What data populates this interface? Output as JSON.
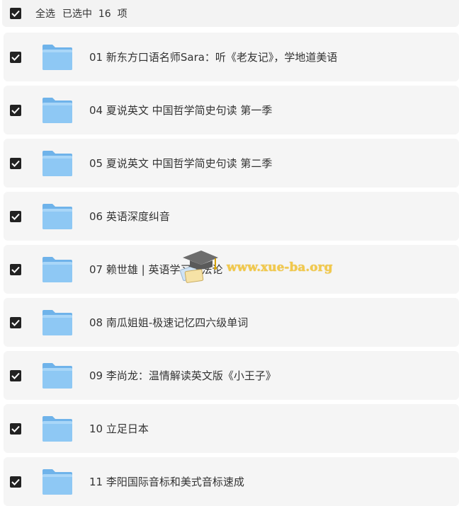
{
  "header": {
    "select_all_label": "全选",
    "selected_count_label": "已选中  16  项"
  },
  "items": [
    {
      "name": "01 新东方口语名师Sara：听《老友记》，学地道美语",
      "checked": true,
      "icon": "folder-icon"
    },
    {
      "name": "04 夏说英文 中国哲学简史句读 第一季",
      "checked": true,
      "icon": "folder-icon"
    },
    {
      "name": "05 夏说英文 中国哲学简史句读 第二季",
      "checked": true,
      "icon": "folder-icon"
    },
    {
      "name": "06 英语深度纠音",
      "checked": true,
      "icon": "folder-icon"
    },
    {
      "name": "07 赖世雄 | 英语学习方法论",
      "checked": true,
      "icon": "folder-icon"
    },
    {
      "name": "08 南瓜姐姐-极速记忆四六级单词",
      "checked": true,
      "icon": "folder-icon"
    },
    {
      "name": "09 李尚龙：温情解读英文版《小王子》",
      "checked": true,
      "icon": "folder-icon"
    },
    {
      "name": "10 立足日本",
      "checked": true,
      "icon": "folder-icon"
    },
    {
      "name": "11 李阳国际音标和美式音标速成",
      "checked": true,
      "icon": "folder-icon"
    }
  ],
  "watermark": {
    "text": "www.xue-ba.org",
    "icon": "graduation-cap-icon"
  },
  "colors": {
    "checkbox": "#222222",
    "folder_front": "#8ec8f4",
    "folder_back": "#6fb3ea",
    "row_bg": "#f5f5f5"
  }
}
